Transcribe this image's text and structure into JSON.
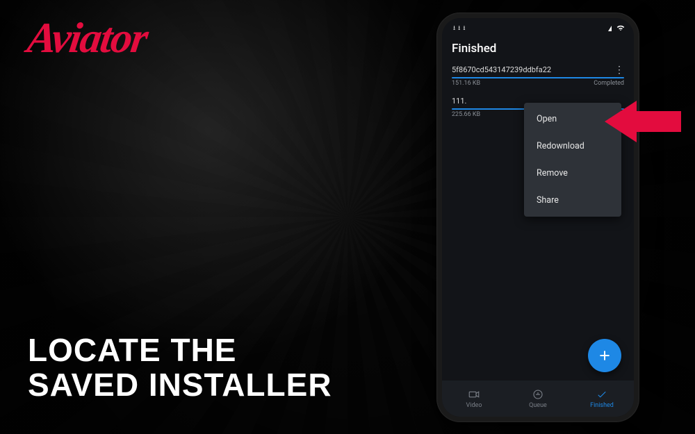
{
  "brand": "Aviator",
  "caption_line1": "LOCATE THE",
  "caption_line2": "SAVED INSTALLER",
  "colors": {
    "accent_red": "#E30C3E",
    "accent_blue": "#1E88E5"
  },
  "status_bar": {
    "left_text": "",
    "icons_left": [
      "dl-down-icon",
      "dl-down-icon",
      "dl-down-icon"
    ],
    "icons_right": [
      "signal-icon",
      "wifi-icon"
    ]
  },
  "header": {
    "title": "Finished"
  },
  "downloads": [
    {
      "name": "5f8670cd543147239ddbfa22",
      "size": "151.16 KB",
      "status": "Completed"
    },
    {
      "name": "111.",
      "size": "225.66 KB",
      "status": ""
    }
  ],
  "context_menu": {
    "items": [
      "Open",
      "Redownload",
      "Remove",
      "Share"
    ]
  },
  "fab": {
    "icon": "plus-icon"
  },
  "nav": {
    "items": [
      {
        "label": "Video",
        "icon": "video-icon",
        "active": false
      },
      {
        "label": "Queue",
        "icon": "queue-icon",
        "active": false
      },
      {
        "label": "Finished",
        "icon": "check-icon",
        "active": true
      }
    ]
  }
}
